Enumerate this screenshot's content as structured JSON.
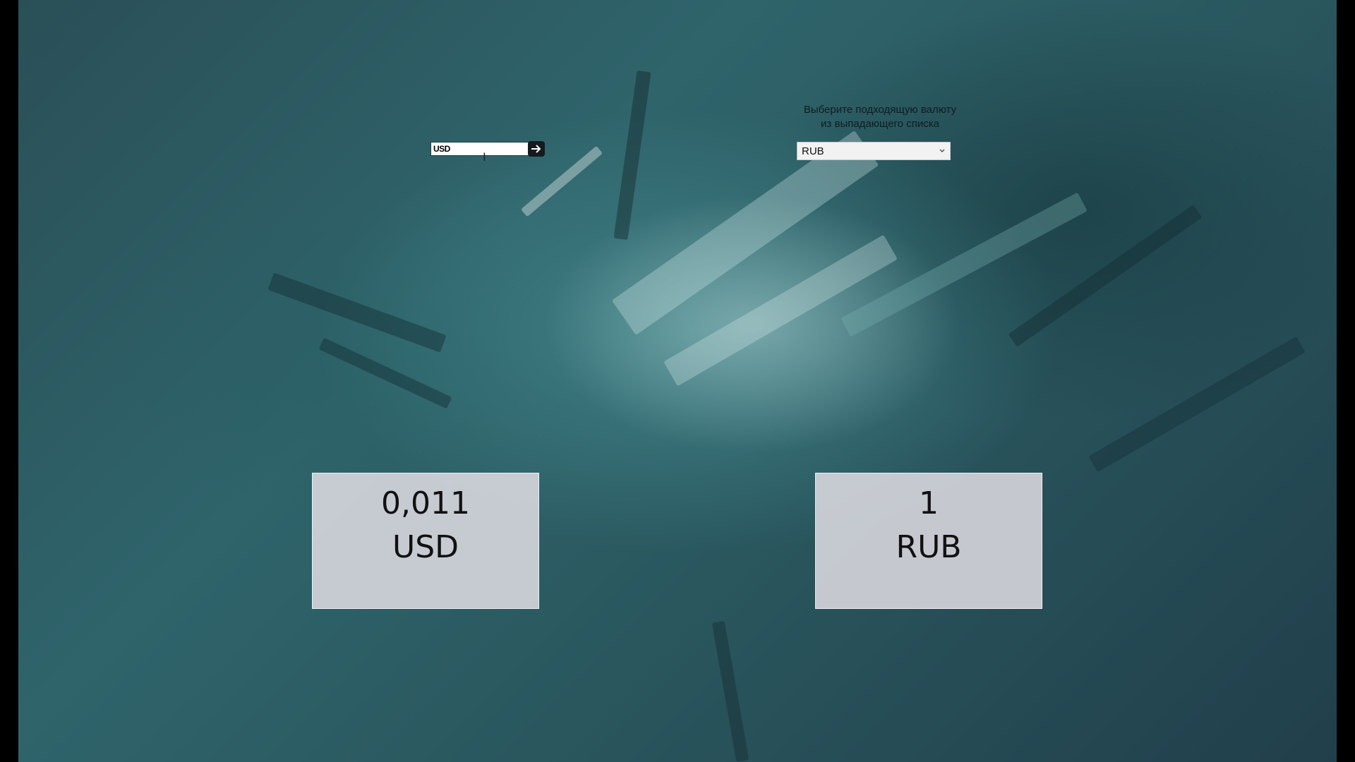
{
  "converter": {
    "input_value": "USD",
    "hint_line1": "Выберите подходящую валюту",
    "hint_line2": "из выпадающего списка",
    "selected_currency": "RUB"
  },
  "results": {
    "from": {
      "amount": "0,011",
      "currency": "USD"
    },
    "to": {
      "amount": "1",
      "currency": "RUB"
    }
  },
  "icons": {
    "submit": "arrow-right-icon",
    "dropdown": "chevron-down-icon",
    "cursor": "text-cursor-icon"
  },
  "colors": {
    "background": "#2f646b",
    "card": "#e4e0e6",
    "submit_button": "#141a1e"
  }
}
